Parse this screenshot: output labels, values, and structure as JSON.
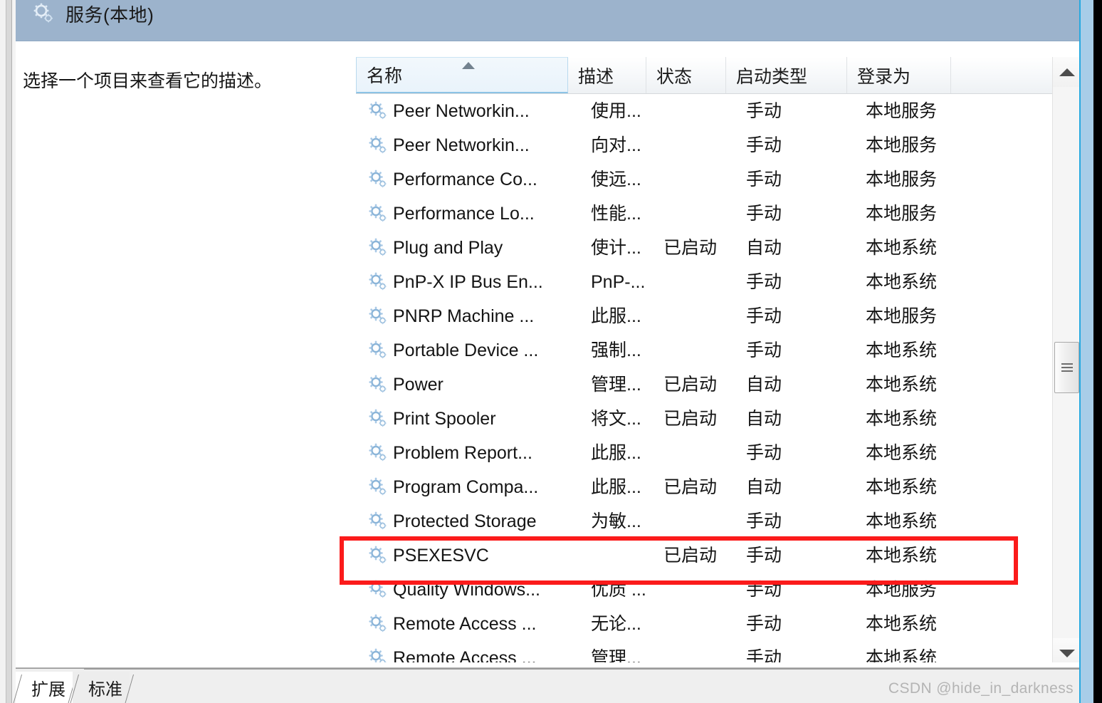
{
  "window": {
    "title": "服务(本地)",
    "title_icon": "services-gear-icon"
  },
  "description_pane": {
    "hint_text": "选择一个项目来查看它的描述。"
  },
  "listview": {
    "sorted_column": "名称",
    "sort_direction": "ascending",
    "columns": [
      {
        "key": "name",
        "label": "名称"
      },
      {
        "key": "desc",
        "label": "描述"
      },
      {
        "key": "status",
        "label": "状态"
      },
      {
        "key": "start",
        "label": "启动类型"
      },
      {
        "key": "logon",
        "label": "登录为"
      }
    ],
    "rows": [
      {
        "name": "Peer Networkin...",
        "desc": "使用...",
        "status": "",
        "start": "手动",
        "logon": "本地服务",
        "highlighted": false
      },
      {
        "name": "Peer Networkin...",
        "desc": "向对...",
        "status": "",
        "start": "手动",
        "logon": "本地服务",
        "highlighted": false
      },
      {
        "name": "Performance Co...",
        "desc": "使远...",
        "status": "",
        "start": "手动",
        "logon": "本地服务",
        "highlighted": false
      },
      {
        "name": "Performance Lo...",
        "desc": "性能...",
        "status": "",
        "start": "手动",
        "logon": "本地服务",
        "highlighted": false
      },
      {
        "name": "Plug and Play",
        "desc": "使计...",
        "status": "已启动",
        "start": "自动",
        "logon": "本地系统",
        "highlighted": false
      },
      {
        "name": "PnP-X IP Bus En...",
        "desc": "PnP-...",
        "status": "",
        "start": "手动",
        "logon": "本地系统",
        "highlighted": false
      },
      {
        "name": "PNRP Machine ...",
        "desc": "此服...",
        "status": "",
        "start": "手动",
        "logon": "本地服务",
        "highlighted": false
      },
      {
        "name": "Portable Device ...",
        "desc": "强制...",
        "status": "",
        "start": "手动",
        "logon": "本地系统",
        "highlighted": false
      },
      {
        "name": "Power",
        "desc": "管理...",
        "status": "已启动",
        "start": "自动",
        "logon": "本地系统",
        "highlighted": false
      },
      {
        "name": "Print Spooler",
        "desc": "将文...",
        "status": "已启动",
        "start": "自动",
        "logon": "本地系统",
        "highlighted": false
      },
      {
        "name": "Problem Report...",
        "desc": "此服...",
        "status": "",
        "start": "手动",
        "logon": "本地系统",
        "highlighted": false
      },
      {
        "name": "Program Compa...",
        "desc": "此服...",
        "status": "已启动",
        "start": "自动",
        "logon": "本地系统",
        "highlighted": false
      },
      {
        "name": "Protected Storage",
        "desc": "为敏...",
        "status": "",
        "start": "手动",
        "logon": "本地系统",
        "highlighted": false
      },
      {
        "name": "PSEXESVC",
        "desc": "",
        "status": "已启动",
        "start": "手动",
        "logon": "本地系统",
        "highlighted": true
      },
      {
        "name": "Quality Windows...",
        "desc": "优质 ...",
        "status": "",
        "start": "手动",
        "logon": "本地服务",
        "highlighted": false
      },
      {
        "name": "Remote Access ...",
        "desc": "无论...",
        "status": "",
        "start": "手动",
        "logon": "本地系统",
        "highlighted": false
      },
      {
        "name": "Remote Access ...",
        "desc": "管理...",
        "status": "",
        "start": "手动",
        "logon": "本地系统",
        "highlighted": false
      }
    ]
  },
  "scrollbar": {
    "up_icon": "scroll-up-arrow-icon",
    "down_icon": "scroll-down-arrow-icon",
    "thumb_grip_icon": "scroll-thumb-grip-icon"
  },
  "tabs": [
    {
      "label": "扩展",
      "active": true
    },
    {
      "label": "标准",
      "active": false
    }
  ],
  "watermark": {
    "text": "CSDN @hide_in_darkness"
  },
  "colors": {
    "title_band": "#9cb3cc",
    "highlight_box": "#fb1b1b",
    "sorted_column": "#e9f3fb",
    "window_accent": "#27a9e0"
  }
}
